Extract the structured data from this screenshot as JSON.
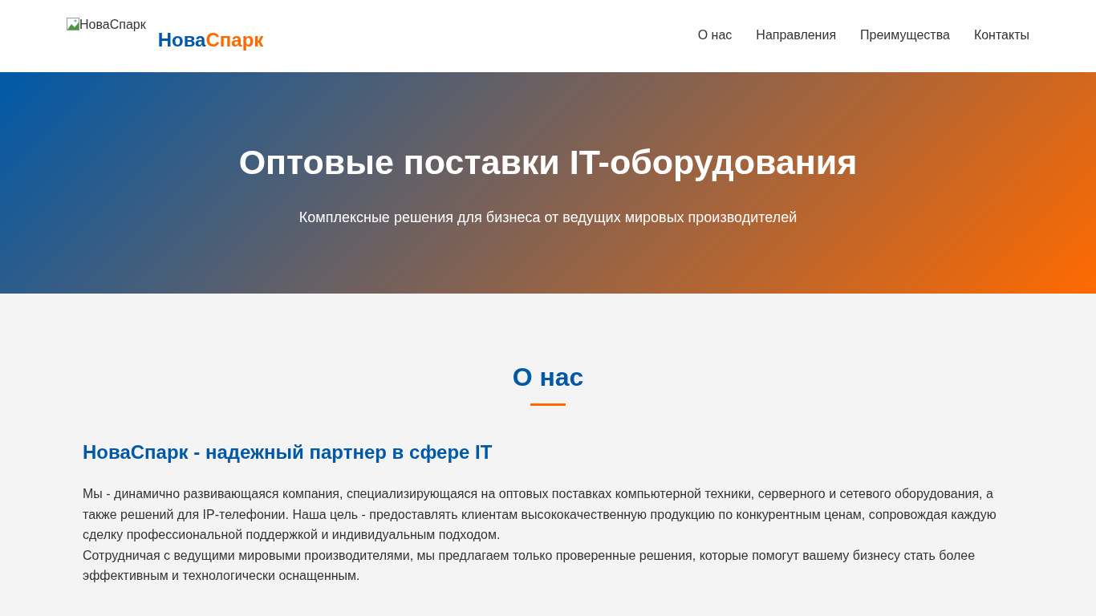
{
  "header": {
    "logo_image_alt": "НоваСпарк",
    "brand": [
      {
        "text": "Нова",
        "color": "#0059a8"
      },
      {
        "text": "Спарк",
        "color": "#ff6a00"
      }
    ],
    "nav": [
      {
        "label": "О нас"
      },
      {
        "label": "Направления"
      },
      {
        "label": "Преимущества"
      },
      {
        "label": "Контакты"
      }
    ]
  },
  "hero": {
    "title": "Оптовые поставки IT-оборудования",
    "subtitle": "Комплексные решения для бизнеса от ведущих мировых производителей"
  },
  "about": {
    "heading": "О нас",
    "subheading": "НоваСпарк - надежный партнер в сфере IT",
    "paragraphs": [
      "Мы - динамично развивающаяся компания, специализирующаяся на оптовых поставках компьютерной техники, серверного и сетевого оборудования, а также решений для IP-телефонии. Наша цель - предоставлять клиентам высококачественную продукцию по конкурентным ценам, сопровождая каждую сделку профессиональной поддержкой и индивидуальным подходом.",
      "Сотрудничая с ведущими мировыми производителями, мы предлагаем только проверенные решения, которые помогут вашему бизнесу стать более эффективным и технологически оснащенным."
    ]
  }
}
